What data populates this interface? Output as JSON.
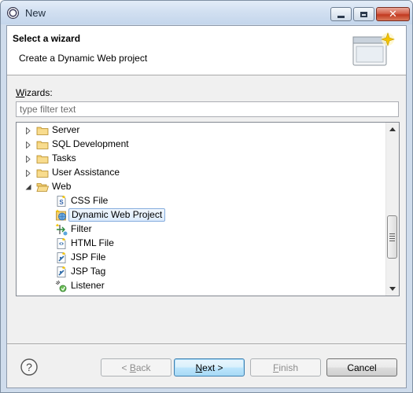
{
  "window": {
    "title": "New"
  },
  "banner": {
    "title": "Select a wizard",
    "description": "Create a Dynamic Web project"
  },
  "wizards": {
    "label_first": "W",
    "label_rest": "izards:",
    "filter_placeholder": "type filter text",
    "filter_value": ""
  },
  "tree": {
    "items": [
      {
        "label": "Server",
        "type": "folder",
        "state": "collapsed",
        "depth": 0,
        "icon": "folder-icon"
      },
      {
        "label": "SQL Development",
        "type": "folder",
        "state": "collapsed",
        "depth": 0,
        "icon": "folder-icon"
      },
      {
        "label": "Tasks",
        "type": "folder",
        "state": "collapsed",
        "depth": 0,
        "icon": "folder-icon"
      },
      {
        "label": "User Assistance",
        "type": "folder",
        "state": "collapsed",
        "depth": 0,
        "icon": "folder-icon"
      },
      {
        "label": "Web",
        "type": "folder",
        "state": "expanded",
        "depth": 0,
        "icon": "folder-open-icon"
      },
      {
        "label": "CSS File",
        "type": "wizard",
        "depth": 1,
        "icon": "css-file-icon"
      },
      {
        "label": "Dynamic Web Project",
        "type": "wizard",
        "depth": 1,
        "icon": "web-project-icon",
        "selected": true
      },
      {
        "label": "Filter",
        "type": "wizard",
        "depth": 1,
        "icon": "filter-icon"
      },
      {
        "label": "HTML File",
        "type": "wizard",
        "depth": 1,
        "icon": "html-file-icon"
      },
      {
        "label": "JSP File",
        "type": "wizard",
        "depth": 1,
        "icon": "jsp-file-icon"
      },
      {
        "label": "JSP Tag",
        "type": "wizard",
        "depth": 1,
        "icon": "jsp-tag-icon"
      },
      {
        "label": "Listener",
        "type": "wizard",
        "depth": 1,
        "icon": "listener-icon"
      }
    ]
  },
  "buttons": {
    "back_prefix": "< ",
    "back_mnemonic": "B",
    "back_rest": "ack",
    "next_mnemonic": "N",
    "next_rest": "ext >",
    "finish_mnemonic": "F",
    "finish_rest": "inish",
    "cancel": "Cancel"
  },
  "colors": {
    "selection_border": "#84acdd",
    "folder": "#e8b94a",
    "default_button_border": "#3c7fb1"
  }
}
